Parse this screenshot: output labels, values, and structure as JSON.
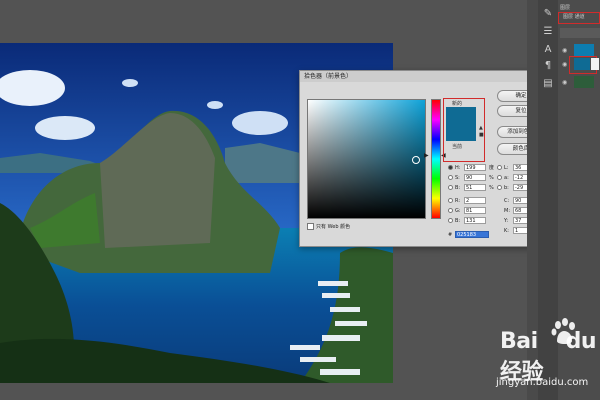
{
  "color_picker": {
    "title": "拾色器（前景色）",
    "close_glyph": "×",
    "buttons": [
      "确定",
      "复位",
      "添加到色板",
      "颜色库"
    ],
    "swatch_new_label": "新的",
    "swatch_current_label": "当前",
    "new_color": "#0f6b94",
    "current_color": "#0f6b94",
    "web_only_label": "只有 Web 颜色",
    "hsb": [
      {
        "label": "H:",
        "value": "199",
        "unit": "度"
      },
      {
        "label": "S:",
        "value": "90",
        "unit": "%"
      },
      {
        "label": "B:",
        "value": "51",
        "unit": "%"
      }
    ],
    "rgb": [
      {
        "label": "R:",
        "value": "2"
      },
      {
        "label": "G:",
        "value": "81"
      },
      {
        "label": "B:",
        "value": "131"
      }
    ],
    "lab": [
      {
        "label": "L:",
        "value": "36"
      },
      {
        "label": "a:",
        "value": "-12"
      },
      {
        "label": "b:",
        "value": "-29"
      }
    ],
    "cmyk": [
      {
        "label": "C:",
        "value": "90",
        "unit": "%"
      },
      {
        "label": "M:",
        "value": "68",
        "unit": "%"
      },
      {
        "label": "Y:",
        "value": "37",
        "unit": "%"
      },
      {
        "label": "K:",
        "value": "1",
        "unit": "%"
      }
    ],
    "hex_label": "#",
    "hex_value": "025183"
  },
  "layers_panel": {
    "top_label": "图层",
    "highlight_label": "图层 通道"
  },
  "watermark": {
    "brand": "Bai",
    "brand_suffix": "du 经验",
    "site": "jingyan.baidu.com"
  }
}
